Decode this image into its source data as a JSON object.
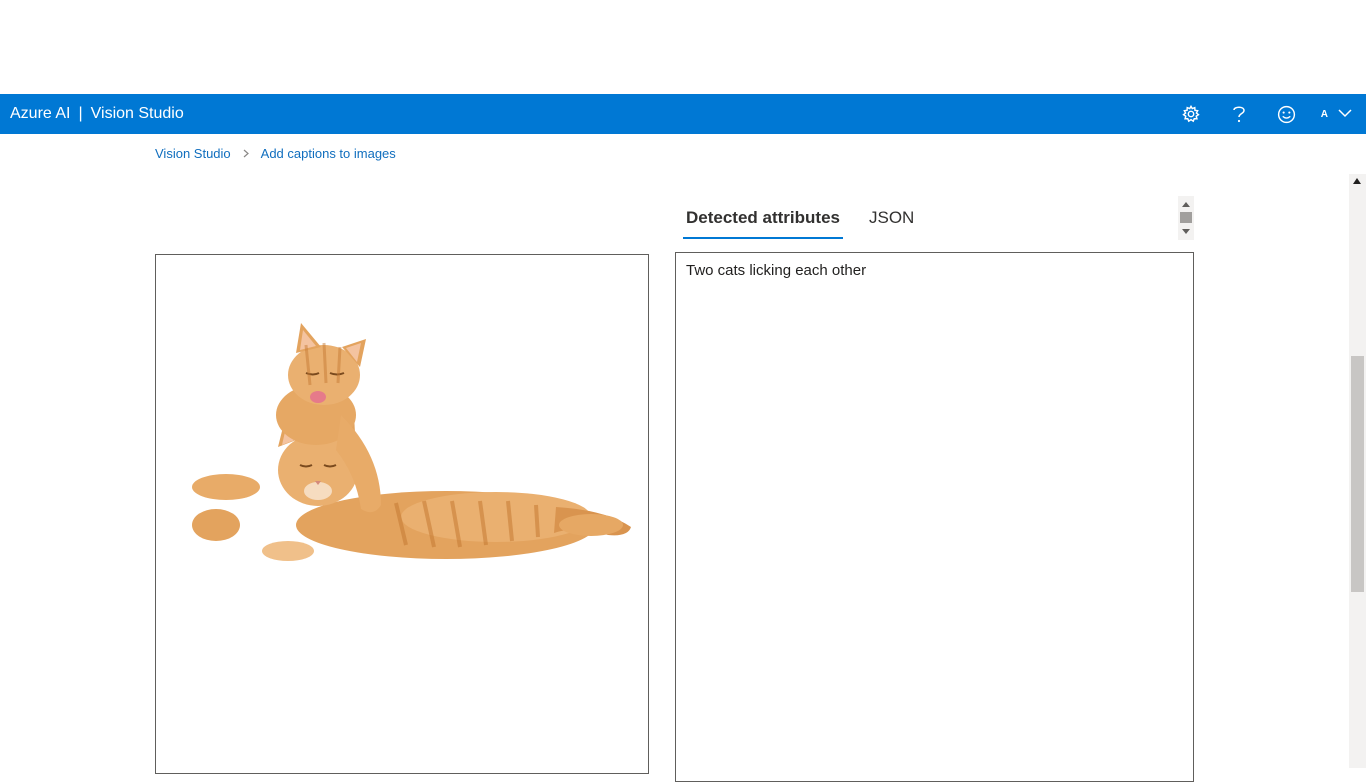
{
  "header": {
    "brand_primary": "Azure AI",
    "brand_separator": "|",
    "brand_secondary": "Vision Studio",
    "account_initial": "A",
    "color": "#0078d4",
    "icons": [
      "settings-gear-icon",
      "help-question-icon",
      "feedback-smiley-icon",
      "chevron-down-icon"
    ]
  },
  "breadcrumb": {
    "items": [
      "Vision Studio",
      "Add captions to images"
    ]
  },
  "image": {
    "subject": "two orange tabby kittens, one licking the other"
  },
  "tabs": [
    {
      "label": "Detected attributes",
      "active": true
    },
    {
      "label": "JSON",
      "active": false
    }
  ],
  "result": {
    "caption": "Two cats licking each other"
  }
}
